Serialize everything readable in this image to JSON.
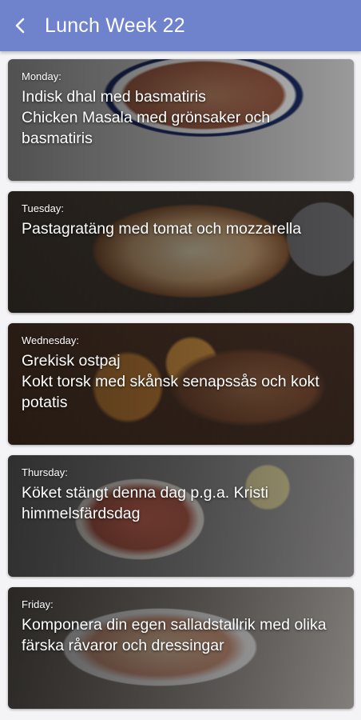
{
  "header": {
    "title": "Lunch Week 22",
    "back_icon": "arrow-back-icon",
    "background_color": "#6f82cc"
  },
  "days": [
    {
      "day": "Monday:",
      "dishes": [
        "Indisk dhal med basmatiris",
        "Chicken Masala med grönsaker och basmatiris"
      ]
    },
    {
      "day": "Tuesday:",
      "dishes": [
        "Pastagratäng med tomat och mozzarella"
      ]
    },
    {
      "day": "Wednesday:",
      "dishes": [
        "Grekisk ostpaj",
        "Kokt torsk med skånsk senapssås och kokt potatis"
      ]
    },
    {
      "day": "Thursday:",
      "dishes": [
        "Köket stängt denna dag p.g.a. Kristi himmelsfärdsdag"
      ]
    },
    {
      "day": "Friday:",
      "dishes": [
        "Komponera din egen salladstallrik med olika färska råvaror och dressingar"
      ]
    }
  ]
}
